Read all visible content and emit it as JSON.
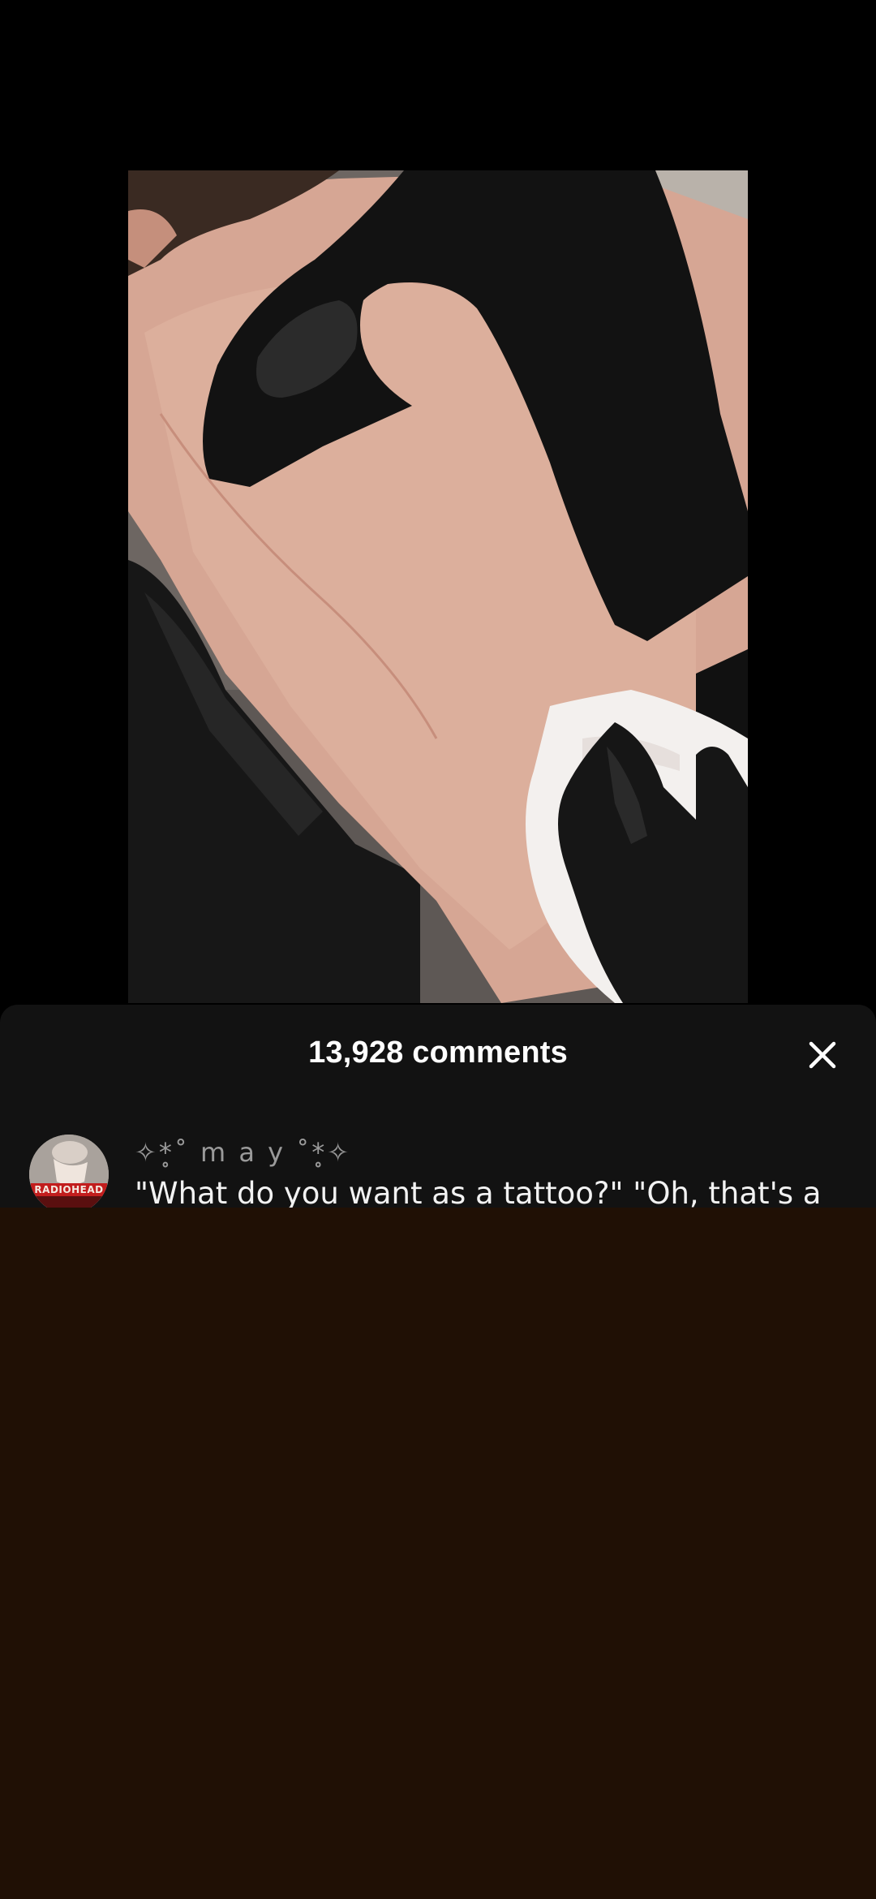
{
  "comments_sheet": {
    "title": "13,928 comments",
    "close_icon": "close-icon"
  },
  "comments": [
    {
      "username": "✧*̥˚ m a y ˚*̥✧",
      "text": "\"What do you want as a tattoo?\" \"Oh, that's a",
      "avatar_label": "RADIOHEAD"
    }
  ],
  "colors": {
    "sheet_background": "#121212",
    "title_text": "#ffffff",
    "username_text": "#9a9a9a",
    "comment_text": "#f2f2f2",
    "bottom_fill": "#201005",
    "video_background": "#000000"
  }
}
